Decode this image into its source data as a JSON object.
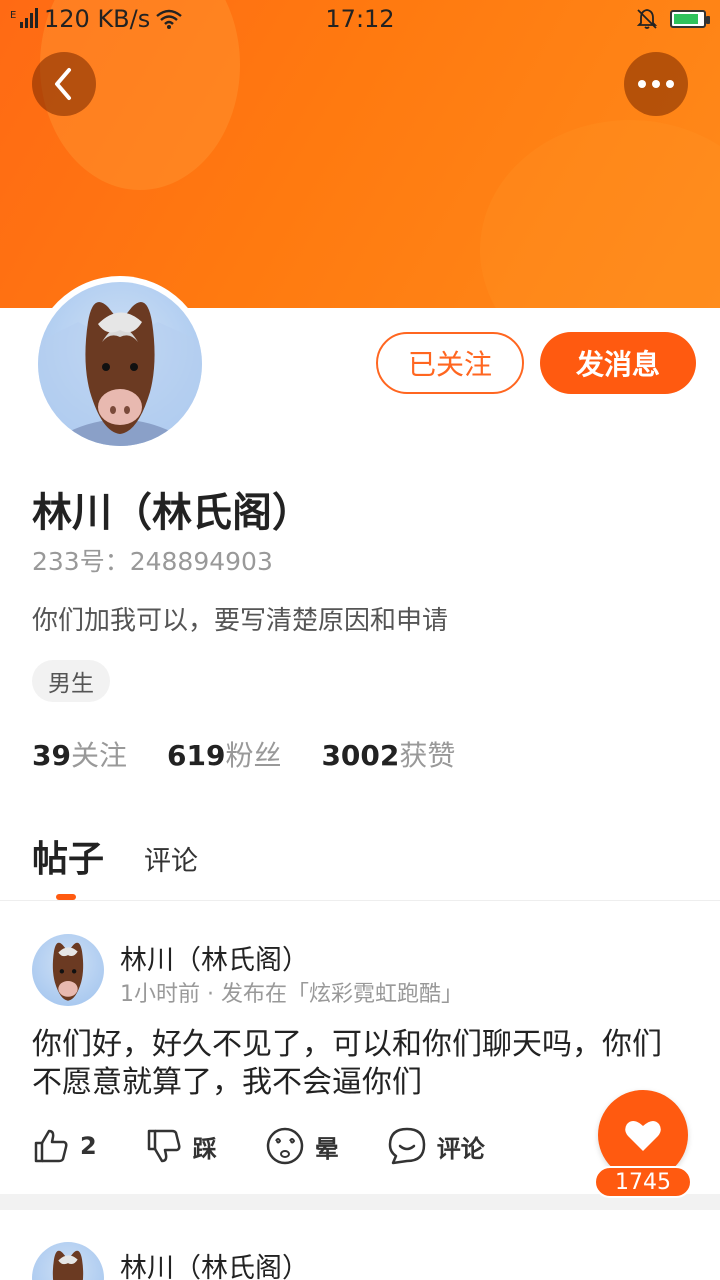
{
  "status_bar": {
    "signal": "E",
    "net_speed": "120 KB/s",
    "time": "17:12"
  },
  "profile": {
    "follow_label": "已关注",
    "message_label": "发消息",
    "name": "林川（林氏阁）",
    "uid": "233号：248894903",
    "bio": "你们加我可以，要写清楚原因和申请",
    "gender_tag": "男生",
    "stats": [
      {
        "value": "39",
        "label": "关注"
      },
      {
        "value": "619",
        "label": "粉丝"
      },
      {
        "value": "3002",
        "label": "获赞"
      }
    ]
  },
  "tabs": [
    {
      "label": "帖子",
      "active": true
    },
    {
      "label": "评论",
      "active": false
    }
  ],
  "posts": [
    {
      "author": "林川（林氏阁）",
      "meta": "1小时前 · 发布在「炫彩霓虹跑酷」",
      "text": "你们好，好久不见了，可以和你们聊天吗，你们不愿意就算了，我不会逼你们",
      "likes": "2",
      "dislike_label": "踩",
      "dizzy_label": "晕",
      "comment_label": "评论"
    },
    {
      "author": "林川（林氏阁）"
    }
  ],
  "like_fab": {
    "count": "1745"
  },
  "colors": {
    "accent": "#ff5a10",
    "header_gradient_start": "#ff6a14",
    "header_gradient_end": "#ff8a1a"
  }
}
